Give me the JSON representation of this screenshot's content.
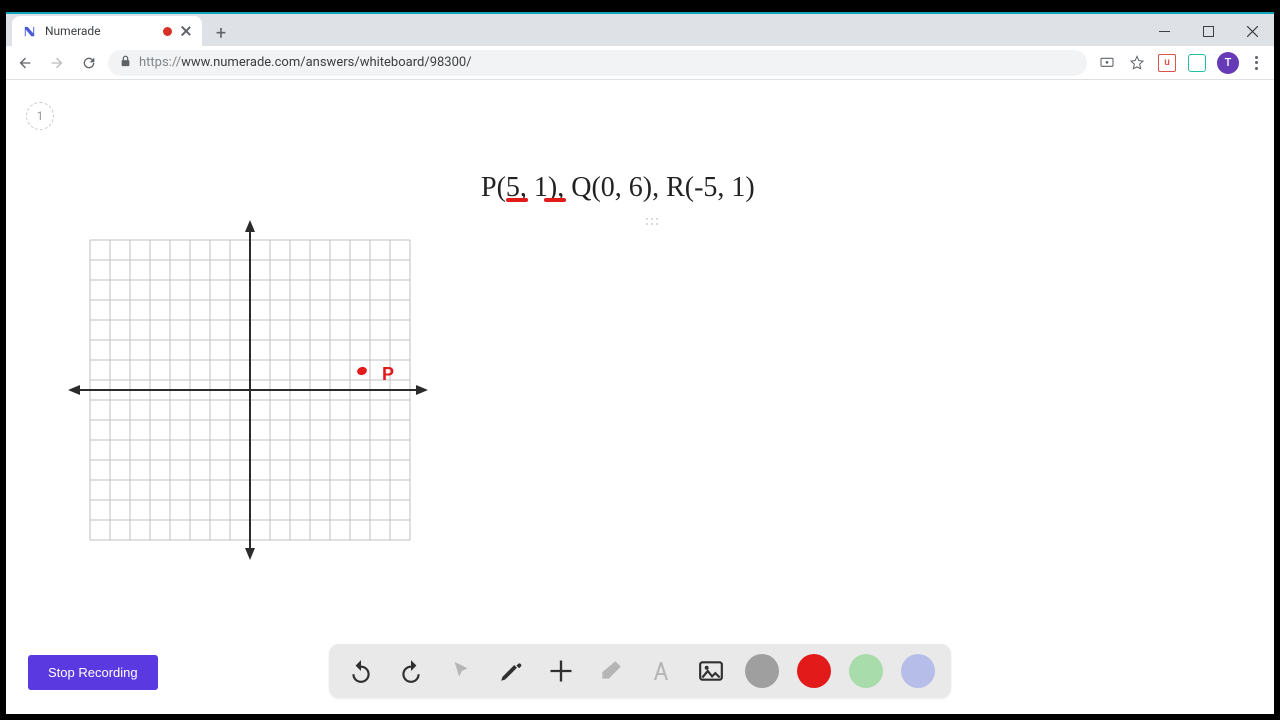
{
  "browser": {
    "tab_title": "Numerade",
    "url_prefix": "https://",
    "url_rest": "www.numerade.com/answers/whiteboard/98300/",
    "avatar_initial": "T"
  },
  "page": {
    "step_number": "1",
    "problem_text": "P(5, 1), Q(0, 6), R(-5, 1)"
  },
  "chart_data": {
    "type": "scatter",
    "xlim": [
      -8,
      8
    ],
    "ylim": [
      -8,
      8
    ],
    "grid_step": 1,
    "points": [
      {
        "label": "P",
        "x": 5,
        "y": 1
      }
    ],
    "underlines": [
      {
        "target": "5"
      },
      {
        "target": "1"
      }
    ]
  },
  "controls": {
    "stop_label": "Stop Recording"
  },
  "toolbar": {
    "undo": "undo",
    "redo": "redo",
    "pointer": "pointer",
    "pen": "pen",
    "add": "add",
    "eraser": "eraser",
    "text": "text",
    "image": "image",
    "colors": [
      "gray",
      "red",
      "green",
      "blue"
    ]
  }
}
